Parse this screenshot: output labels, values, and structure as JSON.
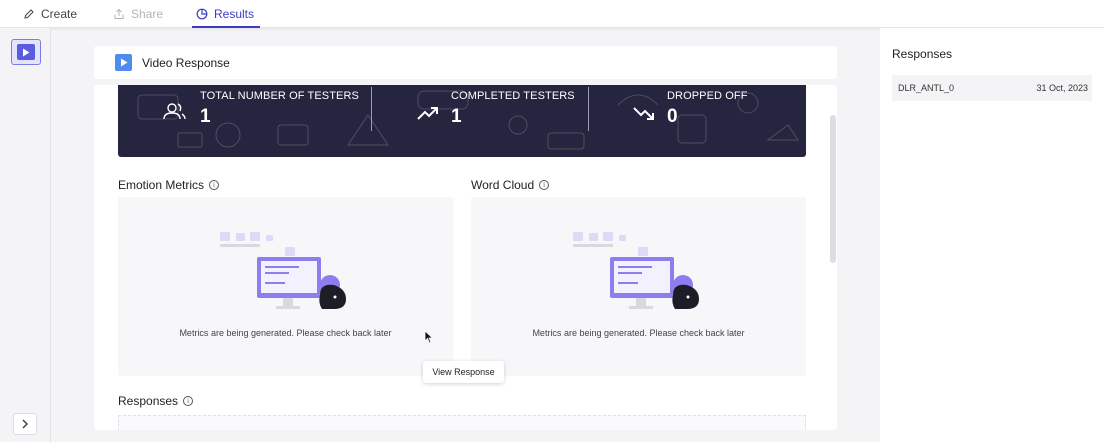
{
  "tabs": [
    {
      "label": "Create",
      "state": "normal"
    },
    {
      "label": "Share",
      "state": "disabled"
    },
    {
      "label": "Results",
      "state": "active"
    }
  ],
  "colors": {
    "accent": "#3b3cc2",
    "banner_bg": "#26253f",
    "video_icon": "#4f8cf2",
    "illustration_purple": "#8b7ff0"
  },
  "header": {
    "title": "Video Response",
    "icon": "video-play-icon"
  },
  "stats": [
    {
      "label": "TOTAL NUMBER OF TESTERS",
      "value": "1",
      "icon": "users-icon"
    },
    {
      "label": "COMPLETED TESTERS",
      "value": "1",
      "icon": "trending-up-icon"
    },
    {
      "label": "DROPPED OFF",
      "value": "0",
      "icon": "trending-down-icon"
    }
  ],
  "emotion_metrics": {
    "title": "Emotion Metrics",
    "message": "Metrics are being generated. Please check back later"
  },
  "word_cloud": {
    "title": "Word Cloud",
    "message": "Metrics are being generated. Please check back later"
  },
  "responses_section": {
    "title": "Responses"
  },
  "tooltip": {
    "text": "View Response"
  },
  "right_panel": {
    "title": "Responses",
    "items": [
      {
        "id": "DLR_ANTL_0",
        "date": "31 Oct, 2023"
      }
    ]
  }
}
